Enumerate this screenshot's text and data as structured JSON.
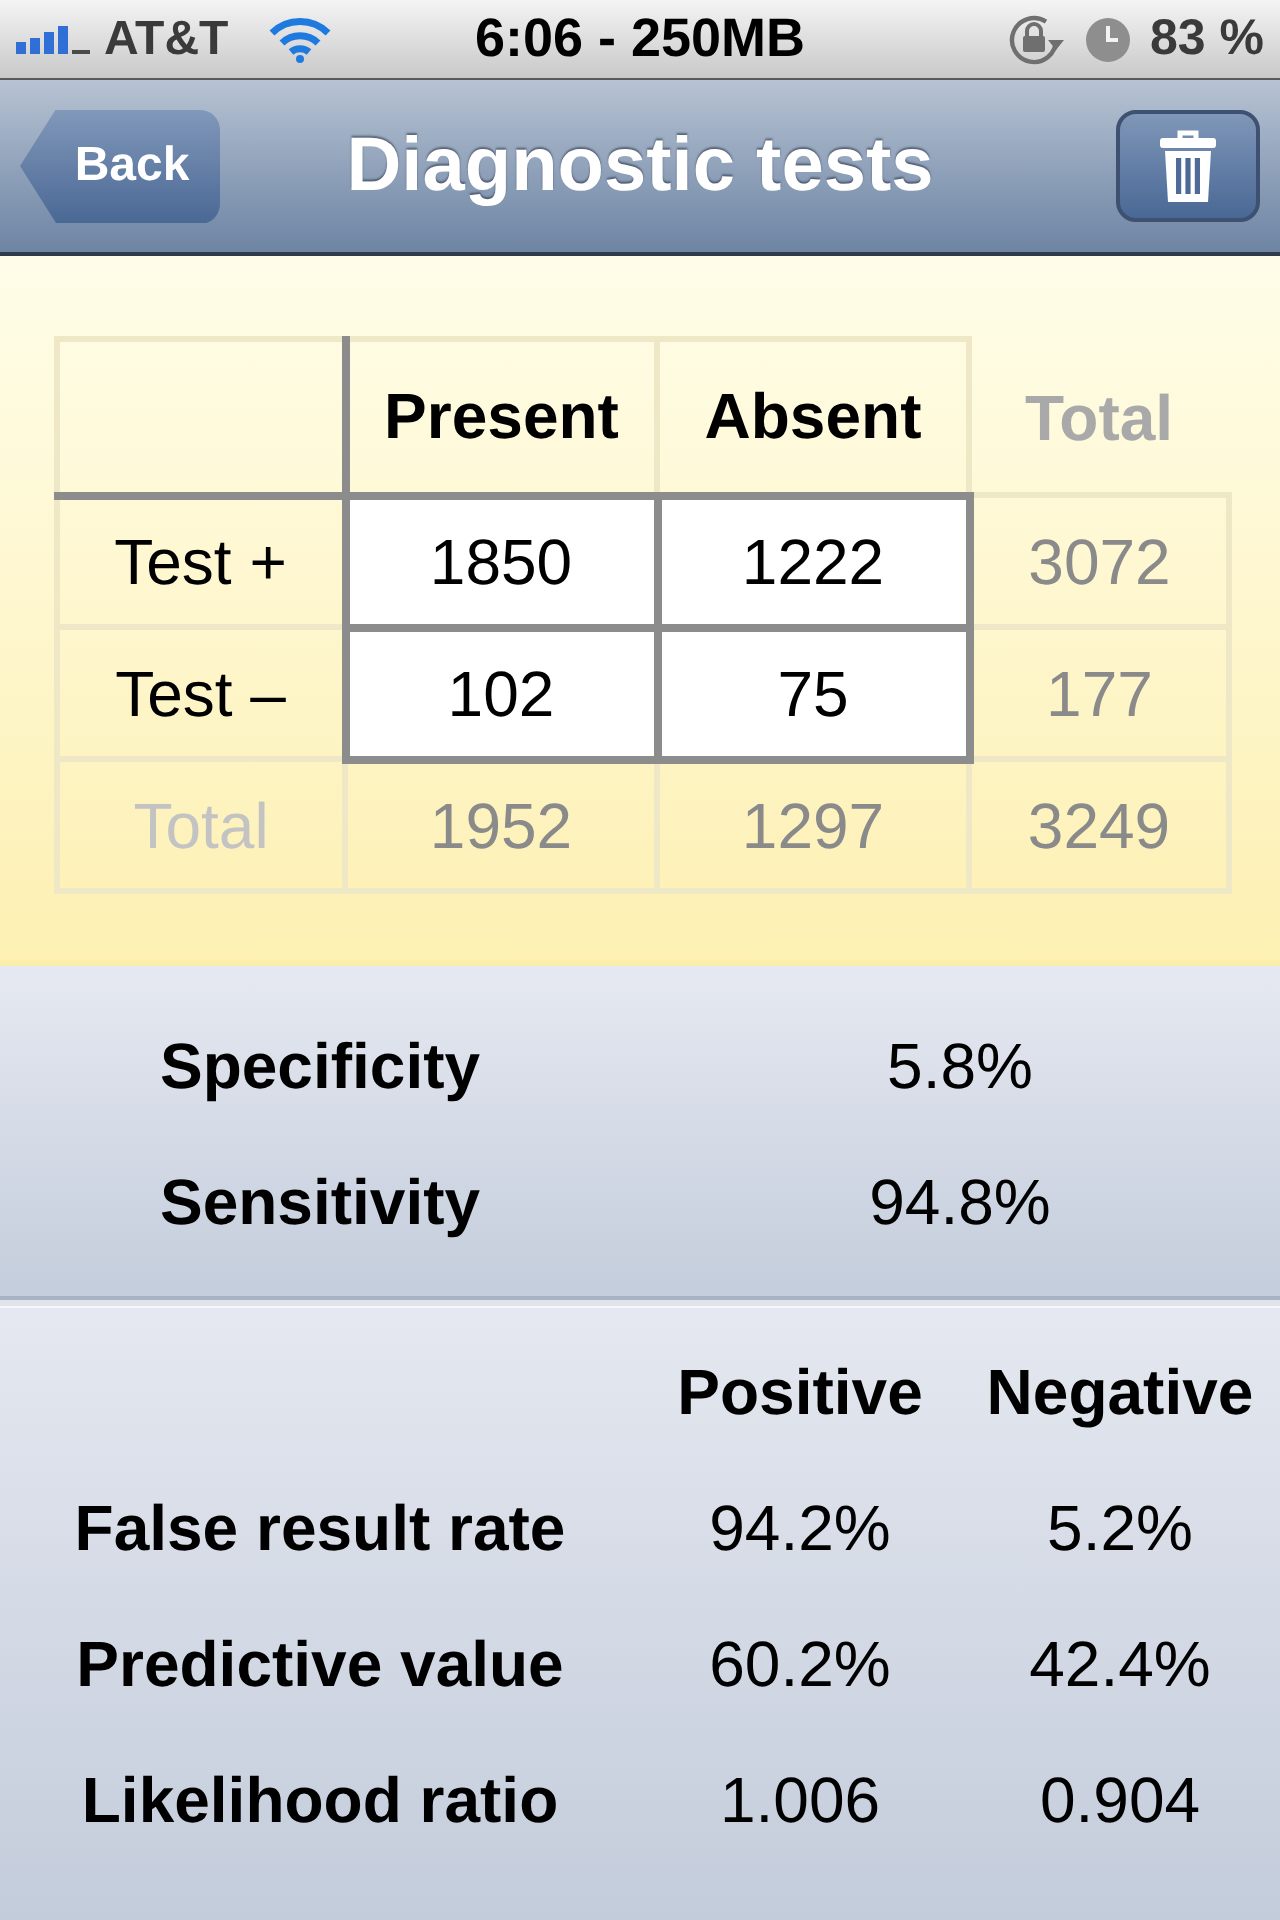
{
  "status_bar": {
    "carrier": "AT&T",
    "time": "6:06 - 250MB",
    "battery": "83 %"
  },
  "nav_bar": {
    "back_button": "Back",
    "title": "Diagnostic tests"
  },
  "contingency_table": {
    "columns": [
      {
        "label": "Present",
        "kind": "input"
      },
      {
        "label": "Absent",
        "kind": "input"
      },
      {
        "label": "Total",
        "kind": "total"
      }
    ],
    "rows": [
      {
        "label": "Test +",
        "kind": "input",
        "values": [
          "1850",
          "1222",
          "3072"
        ]
      },
      {
        "label": "Test –",
        "kind": "input",
        "values": [
          "102",
          "75",
          "177"
        ]
      },
      {
        "label": "Total",
        "kind": "total",
        "values": [
          "1952",
          "1297",
          "3249"
        ]
      }
    ]
  },
  "summary": [
    {
      "label": "Specificity",
      "value": "5.8%"
    },
    {
      "label": "Sensitivity",
      "value": "94.8%"
    }
  ],
  "results": {
    "columns": [
      "Positive",
      "Negative"
    ],
    "rows": [
      {
        "label": "False result rate",
        "values": [
          "94.2%",
          "5.2%"
        ]
      },
      {
        "label": "Predictive value",
        "values": [
          "60.2%",
          "42.4%"
        ]
      },
      {
        "label": "Likelihood ratio",
        "values": [
          "1.006",
          "0.904"
        ]
      }
    ]
  }
}
